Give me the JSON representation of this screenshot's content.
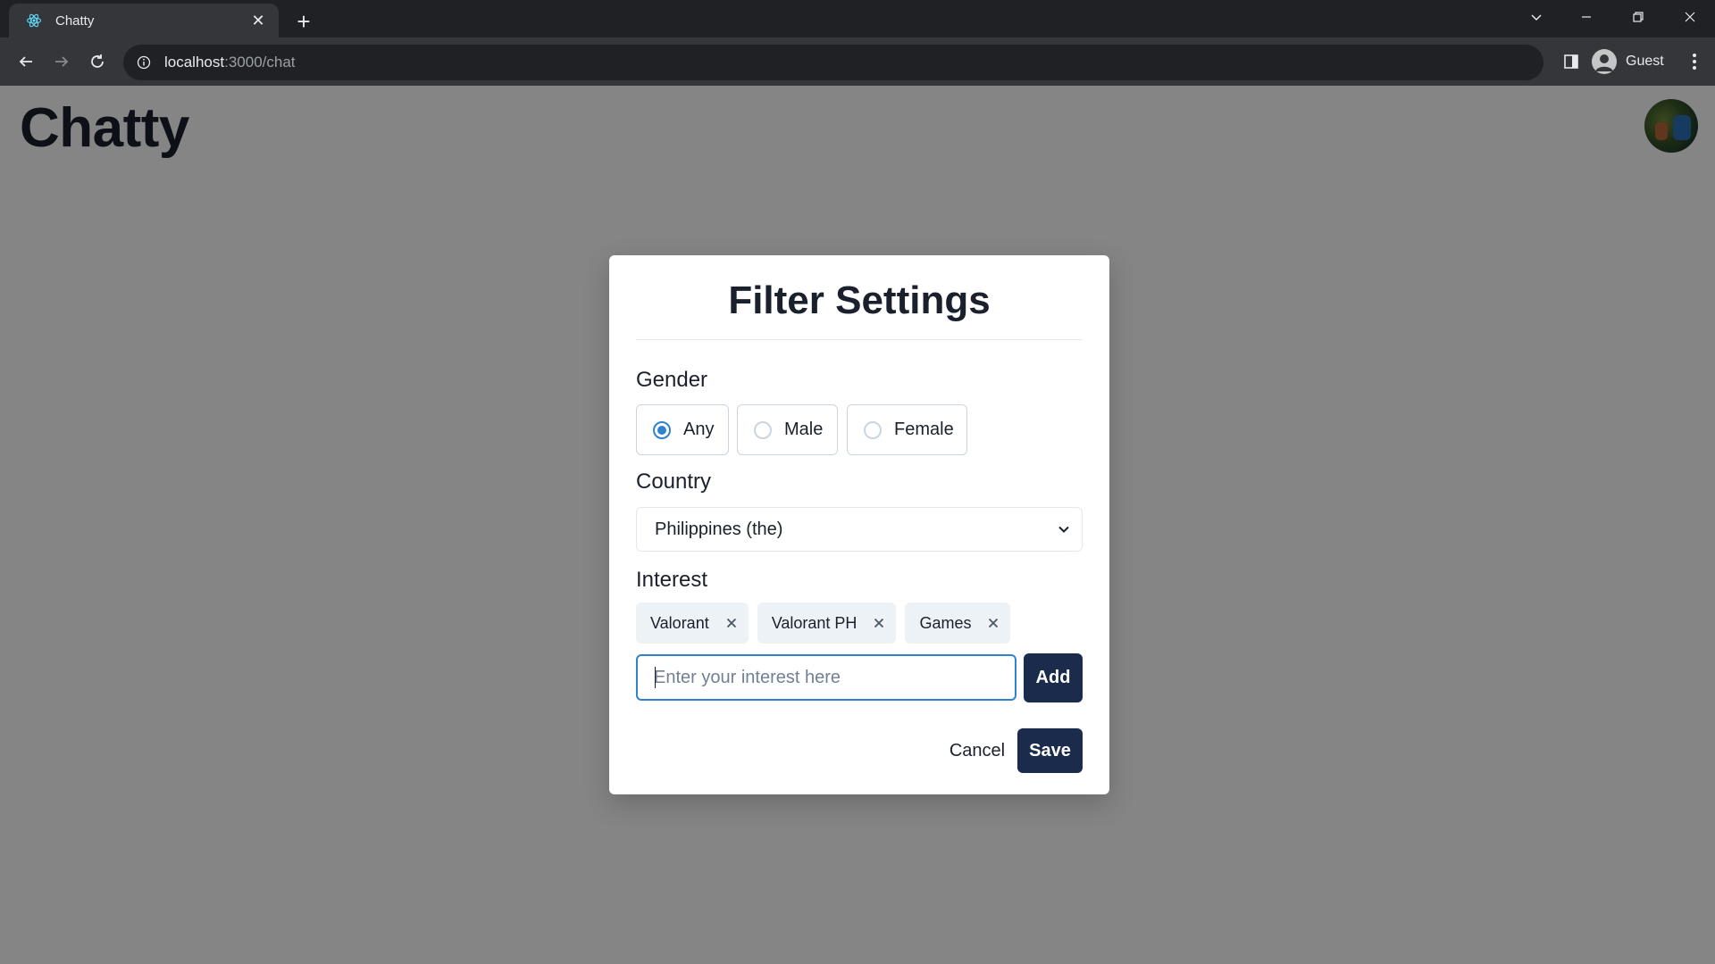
{
  "browser": {
    "tab_title": "Chatty",
    "url_host": "localhost",
    "url_path": ":3000/chat",
    "profile_label": "Guest"
  },
  "page": {
    "app_title": "Chatty"
  },
  "modal": {
    "title": "Filter Settings",
    "gender": {
      "label": "Gender",
      "options": [
        "Any",
        "Male",
        "Female"
      ],
      "selected": "Any"
    },
    "country": {
      "label": "Country",
      "selected": "Philippines (the)"
    },
    "interest": {
      "label": "Interest",
      "tags": [
        "Valorant",
        "Valorant PH",
        "Games"
      ],
      "input_value": "",
      "input_placeholder": "Enter your interest here",
      "add_label": "Add"
    },
    "cancel_label": "Cancel",
    "save_label": "Save"
  },
  "colors": {
    "primary_button": "#1a2b4c",
    "focus_accent": "#3182ce",
    "tag_bg": "#edf2f7",
    "overlay": "rgba(0,0,0,0.48)"
  }
}
